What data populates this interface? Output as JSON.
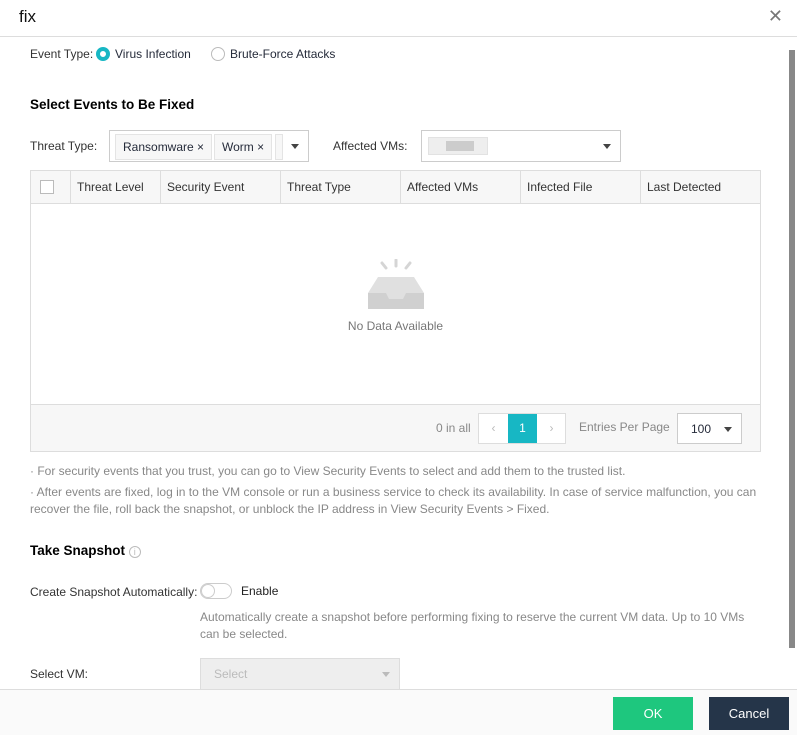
{
  "dialog": {
    "title": "fix",
    "ok": "OK",
    "cancel": "Cancel"
  },
  "event_type": {
    "label": "Event Type:",
    "options": [
      "Virus Infection",
      "Brute-Force Attacks"
    ],
    "selected": "Virus Infection"
  },
  "section1": {
    "title": "Select Events to Be Fixed"
  },
  "filters": {
    "threat_type_label": "Threat Type:",
    "threat_tags": [
      "Ransomware",
      "Worm"
    ],
    "affected_vms_label": "Affected VMs:"
  },
  "table": {
    "columns": [
      "Threat Level",
      "Security Event",
      "Threat Type",
      "Affected VMs",
      "Infected File",
      "Last Detected"
    ],
    "empty_text": "No Data Available"
  },
  "pagination": {
    "total": "0 in all",
    "page": "1",
    "per_page_label": "Entries Per Page",
    "per_page": "100"
  },
  "notes": [
    "· For security events that you trust, you can go to View Security Events to select and add them to the trusted list.",
    "· After events are fixed, log in to the VM console or run a business service to check its availability. In case of service malfunction, you can recover the file, roll back the snapshot, or unblock the IP address in View Security Events > Fixed."
  ],
  "snapshot": {
    "title": "Take Snapshot",
    "auto_label": "Create Snapshot Automatically:",
    "enable": "Enable",
    "enabled": false,
    "hint": "Automatically create a snapshot before performing fixing to reserve the current VM data. Up to 10 VMs can be selected.",
    "vm_label": "Select VM:",
    "vm_placeholder": "Select"
  },
  "colors": {
    "accent": "#17b7c4",
    "ok": "#1ec77e",
    "cancel": "#253549"
  }
}
